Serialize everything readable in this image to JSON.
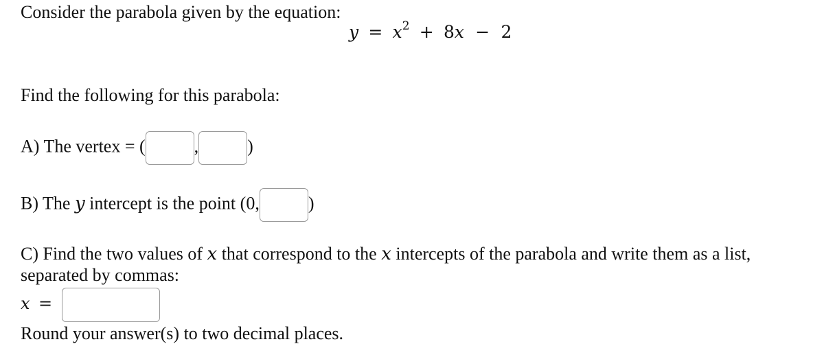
{
  "intro": "Consider the parabola given by the equation:",
  "equation": {
    "lhs": "y",
    "eq": "=",
    "x": "x",
    "exp": "2",
    "plus": "+",
    "coef": "8",
    "x2": "x",
    "minus": "−",
    "const": "2"
  },
  "prompt": "Find the following for this parabola:",
  "partA": {
    "label": "A) The vertex = (",
    "comma": ",",
    "close": ")",
    "inputs": {
      "x_value": "",
      "y_value": ""
    }
  },
  "partB": {
    "prefix": "B) The ",
    "var": "y",
    "suffix": " intercept is the point (0,",
    "close": ")",
    "input_value": ""
  },
  "partC": {
    "text1": "C) Find the two values of ",
    "var1": "x",
    "text2": " that correspond to the ",
    "var2": "x",
    "text3": " intercepts of the parabola and write them as a list,",
    "line2": "separated by commas:",
    "answer_var": "x",
    "answer_eq": "=",
    "input_value": ""
  },
  "note": "Round your answer(s) to two decimal places."
}
